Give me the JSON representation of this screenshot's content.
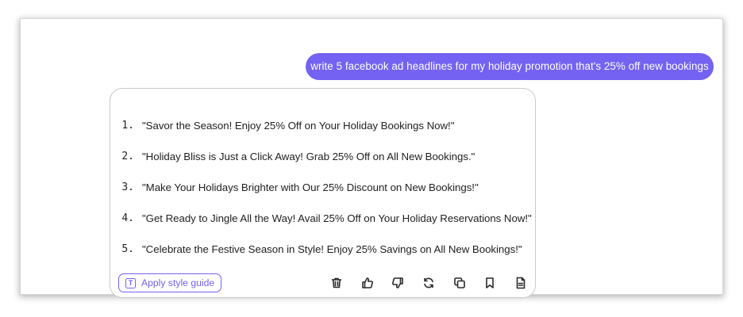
{
  "colors": {
    "accent": "#7462f2",
    "text": "#1f1f1f"
  },
  "conversation": {
    "user_message": "write 5 facebook ad headlines for my holiday promotion that's 25% off new bookings"
  },
  "response": {
    "headlines": [
      {
        "num": "1.",
        "text": "\"Savor the Season! Enjoy 25% Off on Your Holiday Bookings Now!\""
      },
      {
        "num": "2.",
        "text": "\"Holiday Bliss is Just a Click Away! Grab 25% Off on All New Bookings.\""
      },
      {
        "num": "3.",
        "text": "\"Make Your Holidays Brighter with Our 25% Discount on New Bookings!\""
      },
      {
        "num": "4.",
        "text": "\"Get Ready to Jingle All the Way! Avail 25% Off on Your Holiday Reservations Now!\""
      },
      {
        "num": "5.",
        "text": "\"Celebrate the Festive Season in Style! Enjoy 25% Savings on All New Bookings!\""
      }
    ],
    "style_guide_button": {
      "label": "Apply style guide",
      "icon_glyph": "T",
      "icon": "text-format-icon"
    },
    "toolbar_icons": [
      "trash-icon",
      "thumbs-up-icon",
      "thumbs-down-icon",
      "regenerate-icon",
      "copy-icon",
      "bookmark-icon",
      "document-icon"
    ]
  }
}
